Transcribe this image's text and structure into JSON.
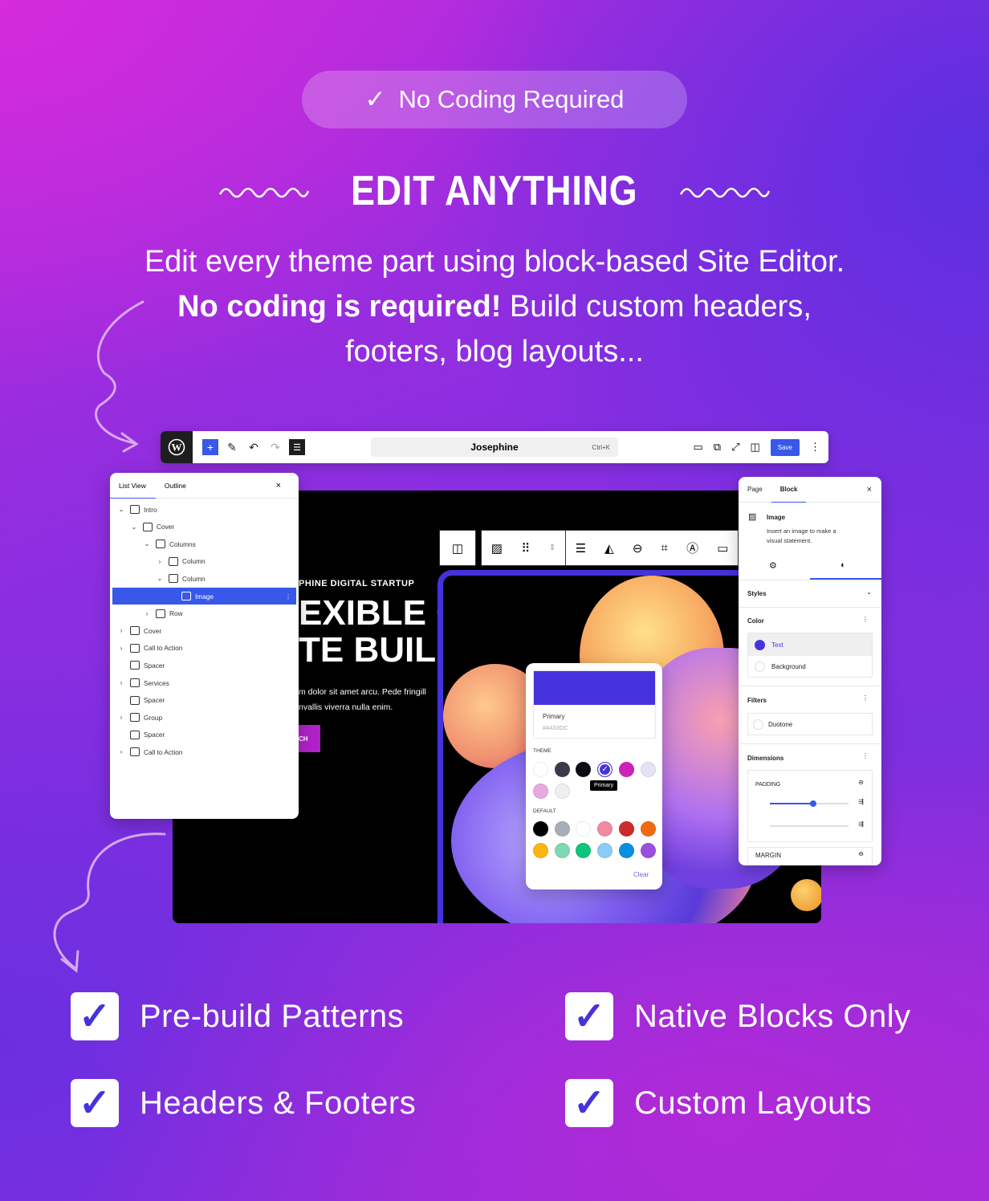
{
  "badge": {
    "icon": "checkmark-icon",
    "label": "No Coding Required"
  },
  "heading": {
    "title": "EDIT ANYTHING"
  },
  "description": {
    "line1": "Edit every theme part using block-based Site Editor.",
    "line2_bold": "No coding is required!",
    "line2_rest": " Build custom headers,",
    "line3": "footers, blog layouts..."
  },
  "editor": {
    "toolbar": {
      "site_title": "Josephine",
      "shortcut": "Ctrl+K",
      "save_label": "Save",
      "add_label": "+"
    },
    "list_view": {
      "tabs": [
        "List View",
        "Outline"
      ],
      "close": "×",
      "items": [
        {
          "label": "Intro",
          "level": 0,
          "expander": "down",
          "icon": "group-icon"
        },
        {
          "label": "Cover",
          "level": 1,
          "expander": "down",
          "icon": "cover-icon"
        },
        {
          "label": "Columns",
          "level": 2,
          "expander": "down",
          "icon": "columns-icon"
        },
        {
          "label": "Column",
          "level": 3,
          "expander": "right",
          "icon": "column-icon"
        },
        {
          "label": "Column",
          "level": 3,
          "expander": "down",
          "icon": "column-icon"
        },
        {
          "label": "Image",
          "level": 4,
          "expander": "",
          "icon": "image-icon",
          "selected": true
        },
        {
          "label": "Row",
          "level": 2,
          "expander": "right",
          "icon": "row-icon"
        },
        {
          "label": "Cover",
          "level": 0,
          "expander": "right",
          "icon": "cover-icon"
        },
        {
          "label": "Call to Action",
          "level": 0,
          "expander": "right",
          "icon": "group-icon"
        },
        {
          "label": "Spacer",
          "level": 0,
          "expander": "",
          "icon": "spacer-icon"
        },
        {
          "label": "Services",
          "level": 0,
          "expander": "right",
          "icon": "group-icon"
        },
        {
          "label": "Spacer",
          "level": 0,
          "expander": "",
          "icon": "spacer-icon"
        },
        {
          "label": "Group",
          "level": 0,
          "expander": "right",
          "icon": "group-icon"
        },
        {
          "label": "Spacer",
          "level": 0,
          "expander": "",
          "icon": "spacer-icon"
        },
        {
          "label": "Call to Action",
          "level": 0,
          "expander": "right",
          "icon": "group-icon"
        }
      ]
    },
    "canvas": {
      "eyebrow": "PHINE DIGITAL STARTUP",
      "headline1": "EXIBLE ✳",
      "headline2": "TE BUILDER",
      "body1": "m dolor sit amet arcu. Pede fringill",
      "body2": "nvallis viverra nulla enim.",
      "button": "CH"
    },
    "color_picker": {
      "selected_name": "Primary",
      "selected_hex": "#4433DC",
      "theme_label": "THEME",
      "default_label": "DEFAULT",
      "tooltip": "Primary",
      "clear_label": "Clear",
      "theme_colors": [
        "#ffffff",
        "#3a3a48",
        "#0b0b14",
        "#4433dc",
        "#cc22bb",
        "#e4e2f4",
        "#e8a8e0",
        "#efefef"
      ],
      "default_colors": [
        "#000000",
        "#a8aeb8",
        "#ffffff",
        "#f08aa0",
        "#cc2a2a",
        "#f26a10",
        "#fbb610",
        "#7fd8b4",
        "#10c47c",
        "#8ccaf8",
        "#0890e0",
        "#9a50dc"
      ]
    },
    "settings": {
      "tabs": [
        "Page",
        "Block"
      ],
      "close": "×",
      "block_name": "Image",
      "block_desc1": "Insert an image to make a",
      "block_desc2": "visual statement.",
      "styles_label": "Styles",
      "color_label": "Color",
      "text_label": "Text",
      "background_label": "Background",
      "filters_label": "Filters",
      "duotone_label": "Duotone",
      "dimensions_label": "Dimensions",
      "padding_label": "PADDING",
      "margin_label": "MARGIN",
      "padding_level": 0.55
    }
  },
  "features": [
    {
      "label": "Pre-build Patterns",
      "checked": true
    },
    {
      "label": "Native Blocks Only",
      "checked": true
    },
    {
      "label": "Headers & Footers",
      "checked": true
    },
    {
      "label": "Custom Layouts",
      "checked": true
    }
  ],
  "colors": {
    "accent": "#4433dc",
    "wp_blue": "#3858e9"
  }
}
